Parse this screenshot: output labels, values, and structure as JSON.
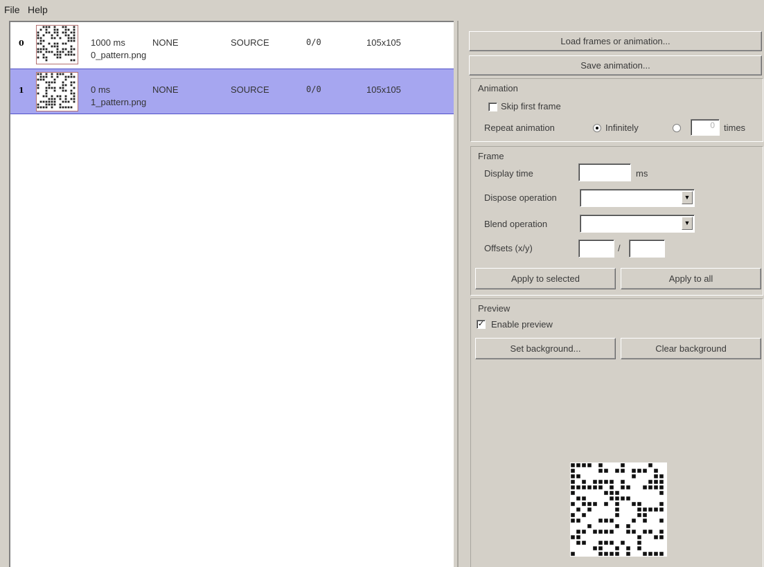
{
  "menu": {
    "file": "File",
    "help": "Help"
  },
  "frames": [
    {
      "index": "0",
      "delay": "1000 ms",
      "dispose": "NONE",
      "blend": "SOURCE",
      "offset": "0/0",
      "size": "105x105",
      "filename": "0_pattern.png",
      "selected": false
    },
    {
      "index": "1",
      "delay": "0 ms",
      "dispose": "NONE",
      "blend": "SOURCE",
      "offset": "0/0",
      "size": "105x105",
      "filename": "1_pattern.png",
      "selected": true
    }
  ],
  "actions": {
    "load": "Load frames or animation...",
    "save": "Save animation..."
  },
  "animation": {
    "title": "Animation",
    "skip_first": "Skip first frame",
    "skip_first_checked": false,
    "repeat_label": "Repeat animation",
    "infinitely": "Infinitely",
    "repeat_count": "0",
    "times": "times"
  },
  "frame_settings": {
    "title": "Frame",
    "display_time": "Display time",
    "ms": "ms",
    "dispose": "Dispose operation",
    "blend": "Blend operation",
    "offsets": "Offsets (x/y)",
    "slash": "/",
    "apply_selected": "Apply to selected",
    "apply_all": "Apply to all"
  },
  "preview": {
    "title": "Preview",
    "enable": "Enable preview",
    "enable_checked": true,
    "set_bg": "Set background...",
    "clear_bg": "Clear background"
  }
}
